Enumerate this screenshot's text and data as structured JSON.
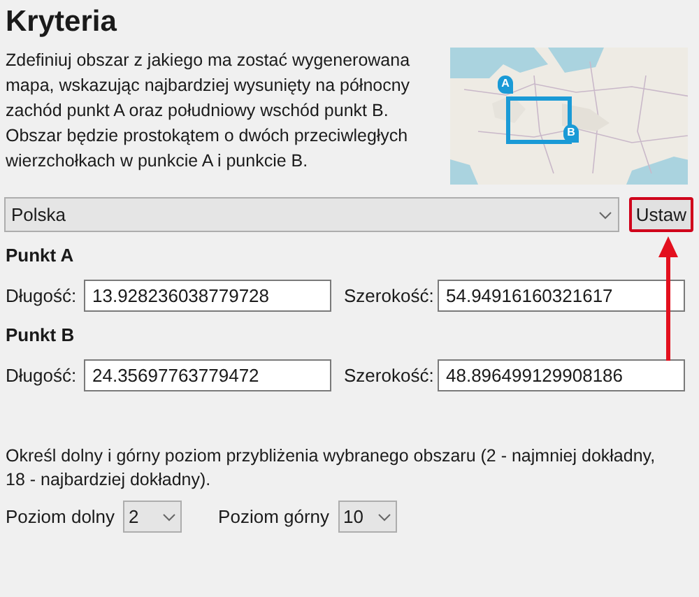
{
  "title": "Kryteria",
  "description": "Zdefiniuj obszar z jakiego ma zostać wygenerowana mapa, wskazując najbardziej wysunięty na północny zachód punkt A oraz południowy wschód punkt B. Obszar będzie prostokątem o dwóch przeciwległych wierzchołkach w punkcie A i punkcie B.",
  "map": {
    "kind": "picture",
    "pins": [
      "A",
      "B"
    ]
  },
  "country": {
    "value": "Polska"
  },
  "set_button": {
    "label": "Ustaw",
    "highlighted": true
  },
  "points": [
    {
      "heading": "Punkt A",
      "fields": [
        {
          "label": "Długość:",
          "value": "13.928236038779728"
        },
        {
          "label": "Szerokość:",
          "value": "54.94916160321617"
        }
      ]
    },
    {
      "heading": "Punkt B",
      "fields": [
        {
          "label": "Długość:",
          "value": "24.35697763779472"
        },
        {
          "label": "Szerokość:",
          "value": "48.896499129908186"
        }
      ]
    }
  ],
  "zoom_note": "Określ dolny i górny poziom przybliżenia wybranego obszaru (2 - najmniej dokładny, 18 - najbardziej dokładny).",
  "zoom_levels": [
    {
      "label": "Poziom dolny",
      "value": "2"
    },
    {
      "label": "Poziom górny",
      "value": "10"
    }
  ]
}
